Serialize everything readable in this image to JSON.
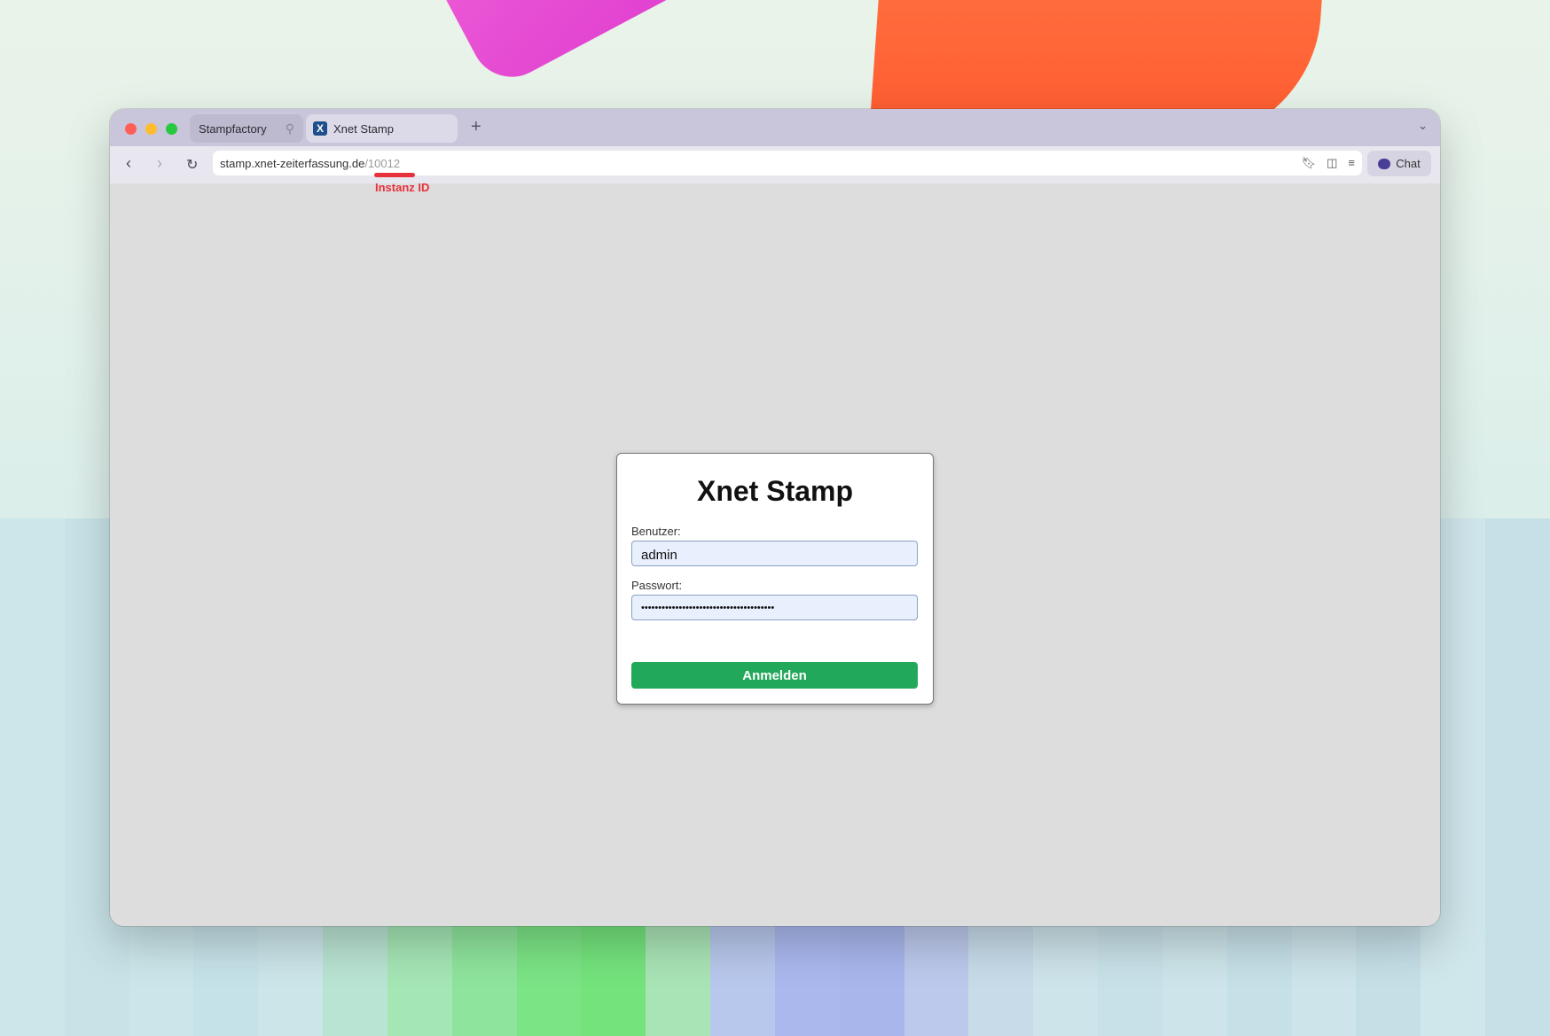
{
  "browser": {
    "tabs": [
      {
        "label": "Stampfactory",
        "pinned": true
      },
      {
        "label": "Xnet Stamp",
        "favicon": "X",
        "active": true
      }
    ],
    "url_host": "stamp.xnet-zeiterfassung.de",
    "url_path": "/10012",
    "chat_label": "Chat"
  },
  "annotation": {
    "label": "Instanz ID",
    "color": "#e8303b"
  },
  "login": {
    "title": "Xnet Stamp",
    "user_label": "Benutzer:",
    "user_value": "admin",
    "password_label": "Passwort:",
    "password_value": "•••••••••••••••••••••••••••••••••••••••",
    "submit_label": "Anmelden",
    "submit_color": "#22a85a"
  }
}
